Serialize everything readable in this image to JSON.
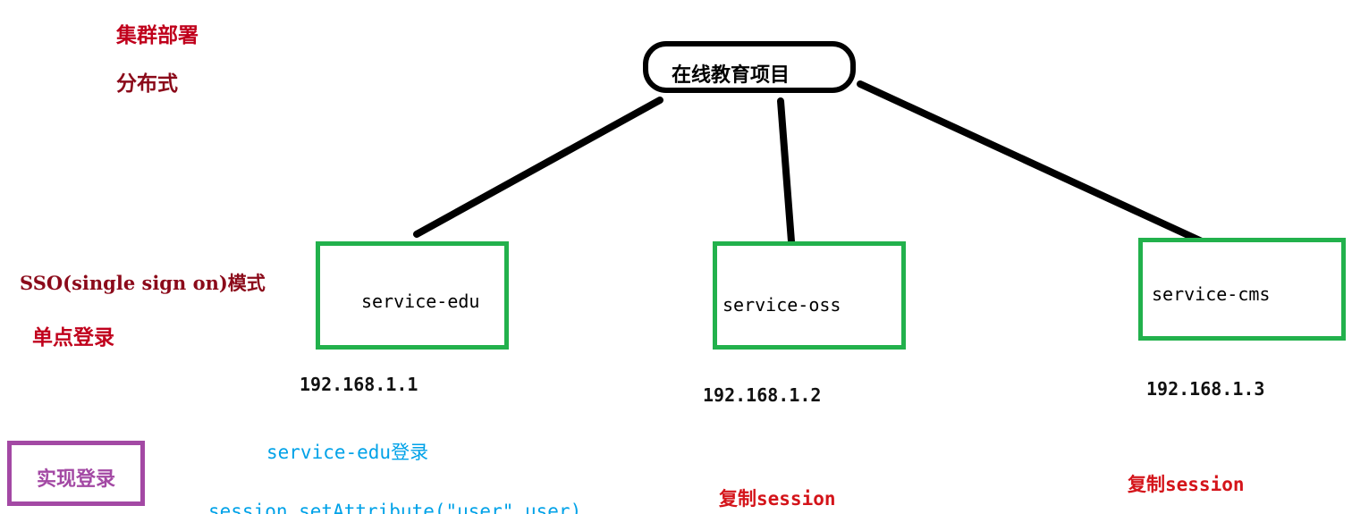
{
  "colors": {
    "link": "#000000",
    "service_border": "#22b14c",
    "impl_border": "#a349a4",
    "note_red": "#c0001c",
    "note_dark_red": "#8b0a1a",
    "note_blue": "#00a2e8"
  },
  "notes": {
    "cluster": "集群部署",
    "distributed": "分布式",
    "sso_mode": "SSO(single sign on)模式",
    "single_login": "单点登录",
    "implement_login": "实现登录",
    "edu_login": "service-edu登录",
    "session_code": "session.setAttribute(\"user\",user)",
    "copy_session_oss": "复制session",
    "copy_session_cms": "复制session"
  },
  "diagram": {
    "root": {
      "label": "在线教育项目"
    },
    "services": [
      {
        "label": "service-edu",
        "ip": "192.168.1.1"
      },
      {
        "label": "service-oss",
        "ip": "192.168.1.2"
      },
      {
        "label": "service-cms",
        "ip": "192.168.1.3"
      }
    ]
  }
}
